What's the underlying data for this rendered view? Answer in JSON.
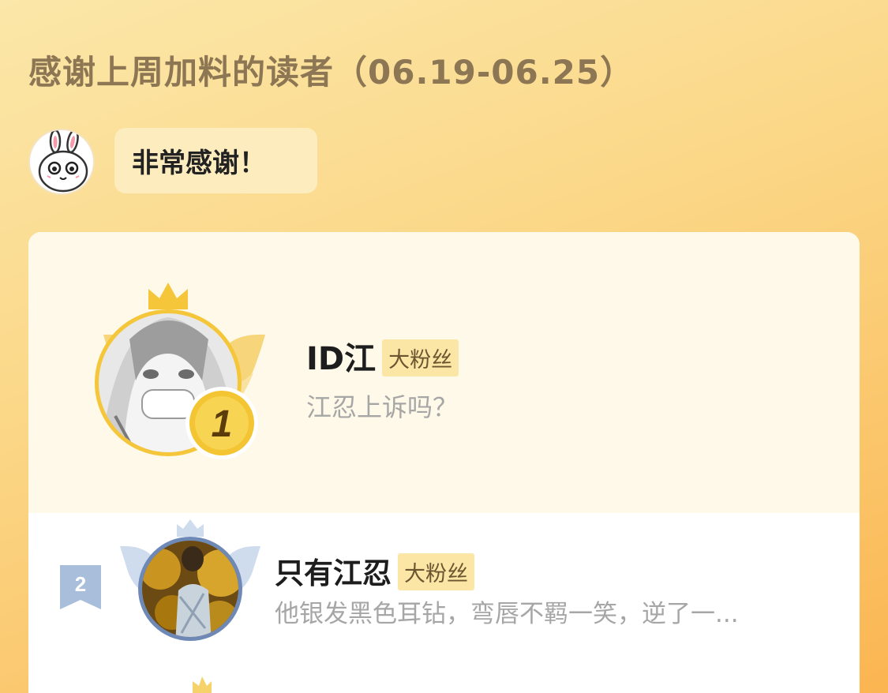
{
  "header": {
    "title": "感谢上周加料的读者（06.19-06.25）"
  },
  "mascot": {
    "icon": "bunny-avatar-icon",
    "message": "非常感谢！"
  },
  "leaderboard": {
    "first": {
      "rank": "1",
      "name": "ID江",
      "badge": "大粉丝",
      "message": "江忍上诉吗？",
      "accent": "#f5c63a"
    },
    "second": {
      "rank": "2",
      "name": "只有江忍",
      "badge": "大粉丝",
      "message": "他银发黑色耳钻，弯唇不羁一笑，逆了一...",
      "accent": "#9fb6d4"
    }
  },
  "colors": {
    "background_top": "#fbe7a9",
    "background_bottom": "#fbb551",
    "title": "#8d7654",
    "bubble": "#fdecbd",
    "badge": "#fbe6a5",
    "muted_text": "#a6a6a6"
  }
}
